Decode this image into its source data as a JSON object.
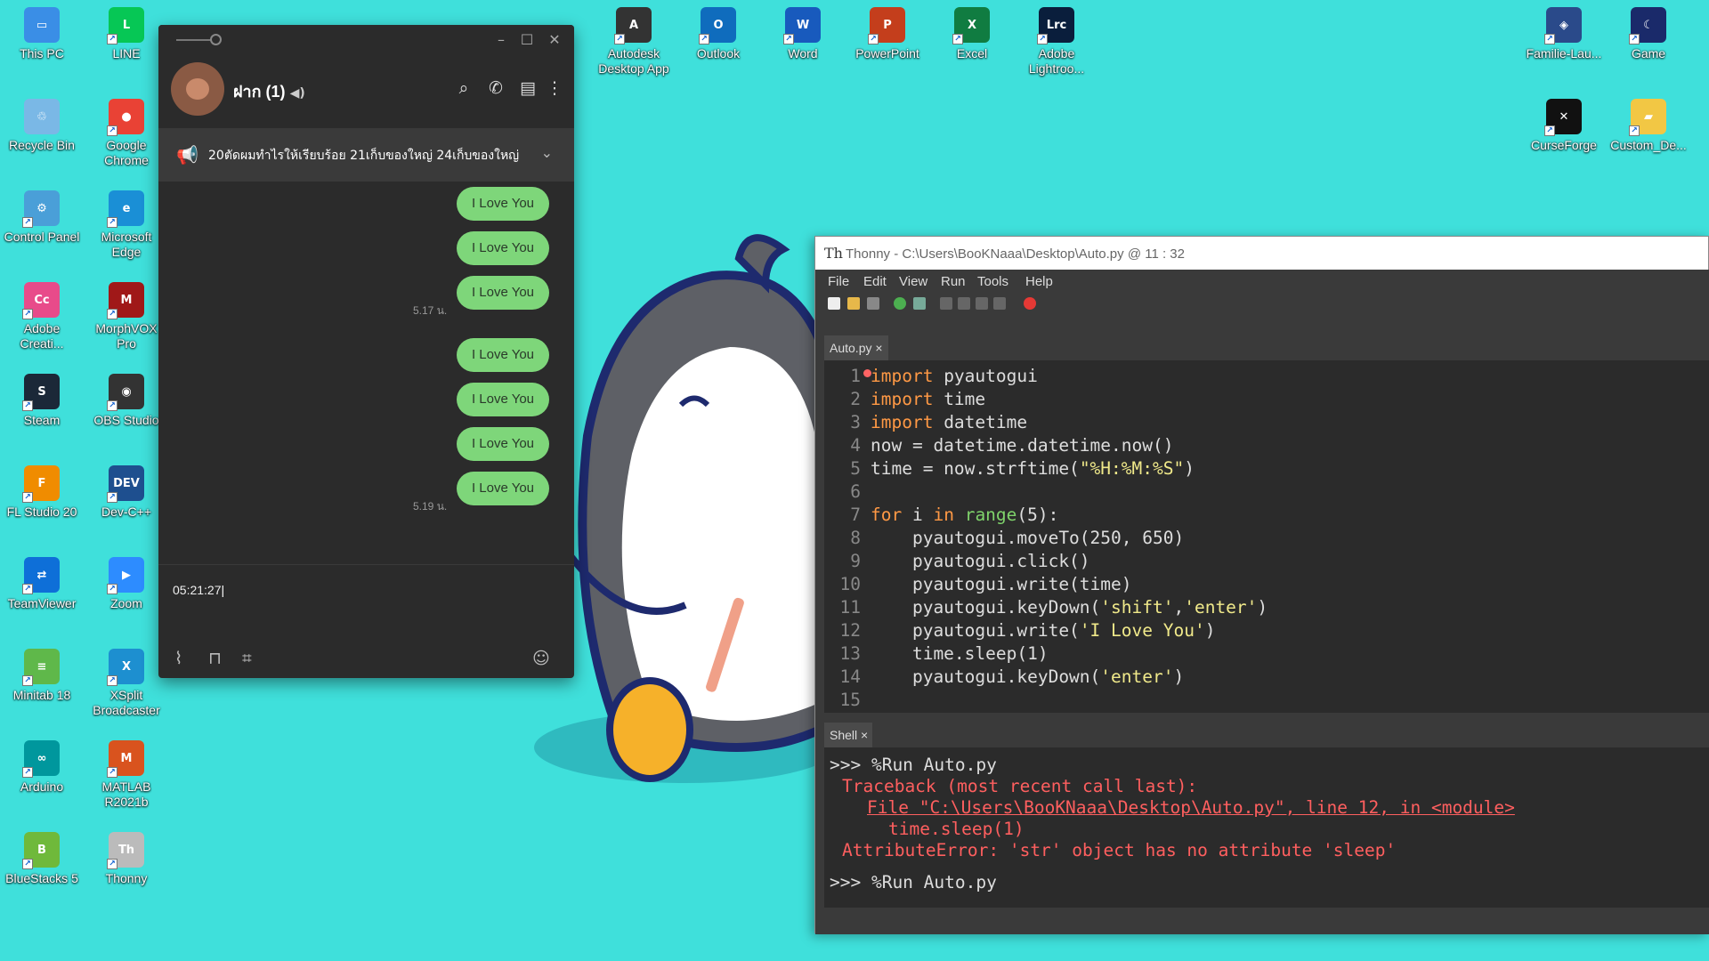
{
  "desktop": {
    "icons": [
      {
        "label": "This PC"
      },
      {
        "label": "LINE"
      },
      {
        "label": "Recycle Bin"
      },
      {
        "label": "Google Chrome"
      },
      {
        "label": "Control Panel"
      },
      {
        "label": "Microsoft Edge"
      },
      {
        "label": "Adobe Creati..."
      },
      {
        "label": "MorphVOX Pro"
      },
      {
        "label": "Steam"
      },
      {
        "label": "OBS Studio"
      },
      {
        "label": "FL Studio 20"
      },
      {
        "label": "Dev-C++"
      },
      {
        "label": "TeamViewer"
      },
      {
        "label": "Zoom"
      },
      {
        "label": "Minitab 18"
      },
      {
        "label": "XSplit Broadcaster"
      },
      {
        "label": "Arduino"
      },
      {
        "label": "MATLAB R2021b"
      },
      {
        "label": "BlueStacks 5"
      },
      {
        "label": "Thonny"
      },
      {
        "label": "Autodesk Desktop App"
      },
      {
        "label": "Outlook"
      },
      {
        "label": "Word"
      },
      {
        "label": "PowerPoint"
      },
      {
        "label": "Excel"
      },
      {
        "label": "Adobe Lightroo..."
      },
      {
        "label": "Familie-Lau..."
      },
      {
        "label": "Game"
      },
      {
        "label": "CurseForge"
      },
      {
        "label": "Custom_De..."
      }
    ]
  },
  "line": {
    "chat_name": "ฝาก (1)",
    "announcement": "20ตัดผมทำไรให้เรียบร้อย 21เก็บของใหญ่ 24เก็บของใหญ่",
    "messages": [
      "I Love You",
      "I Love You",
      "I Love You",
      "I Love You",
      "I Love You",
      "I Love You",
      "I Love You"
    ],
    "timestamps": [
      "5.17 น.",
      "5.19 น."
    ],
    "input_value": "05:21:27"
  },
  "thonny": {
    "title": "Thonny  -  C:\\Users\\BooKNaaa\\Desktop\\Auto.py  @  11 : 32",
    "menu": [
      "File",
      "Edit",
      "View",
      "Run",
      "Tools",
      "Help"
    ],
    "editor_tab": "Auto.py ×",
    "shell_tab": "Shell ×",
    "line_numbers": [
      "1",
      "2",
      "3",
      "4",
      "5",
      "6",
      "7",
      "8",
      "9",
      "10",
      "11",
      "12",
      "13",
      "14",
      "15"
    ],
    "shell": {
      "run1": ">>> %Run Auto.py",
      "tb1": "Traceback (most recent call last):",
      "tb2": "File \"C:\\Users\\BooKNaaa\\Desktop\\Auto.py\", line 12, in <module>",
      "tb3": "time.sleep(1)",
      "tb4": "AttributeError: 'str' object has no attribute 'sleep'",
      "run2": ">>> %Run Auto.py"
    }
  },
  "colors": {
    "desktop_bg": "#3fe0db",
    "bubble": "#7ed67a",
    "keyword": "#ff9945",
    "string": "#f0e98a",
    "error": "#ff5f5f"
  }
}
